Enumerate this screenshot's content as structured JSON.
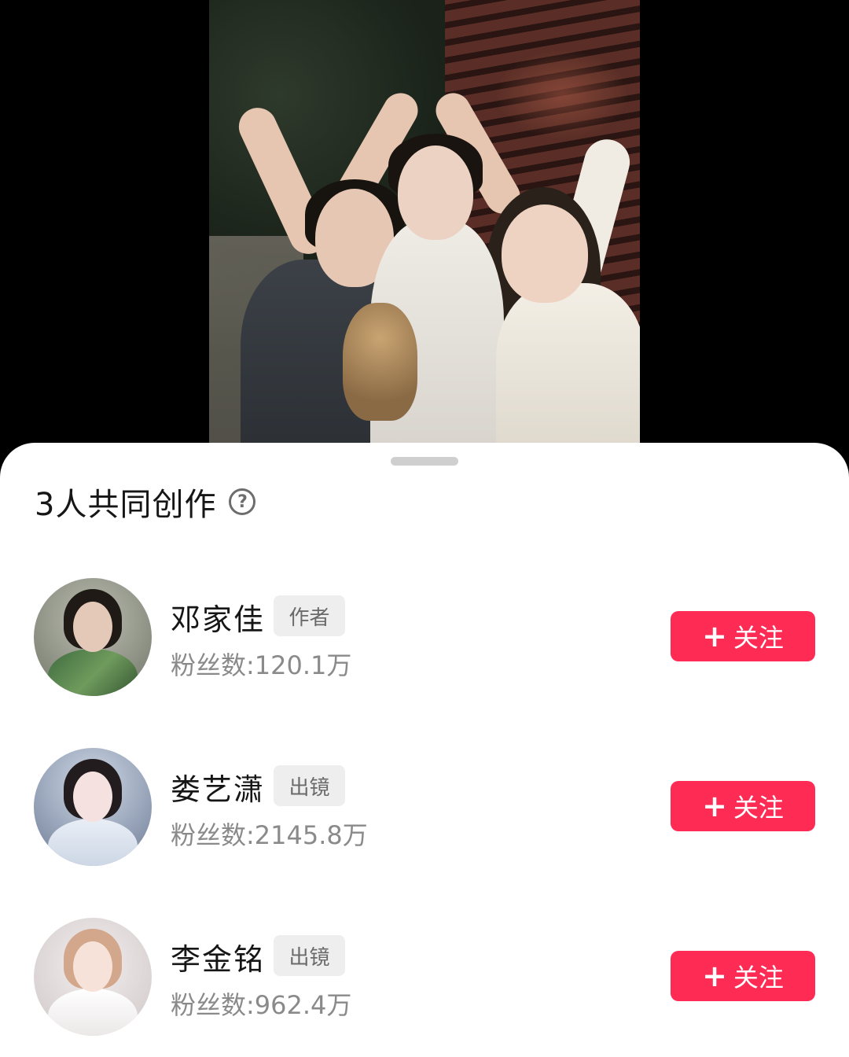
{
  "sheet": {
    "title": "3人共同创作",
    "help_icon": "question-circle-icon"
  },
  "creators": [
    {
      "name": "邓家佳",
      "role": "作者",
      "fans": "粉丝数:120.1万",
      "follow_label": "关注",
      "follow_icon": "plus-icon"
    },
    {
      "name": "娄艺潇",
      "role": "出镜",
      "fans": "粉丝数:2145.8万",
      "follow_label": "关注",
      "follow_icon": "plus-icon"
    },
    {
      "name": "李金铭",
      "role": "出镜",
      "fans": "粉丝数:962.4万",
      "follow_label": "关注",
      "follow_icon": "plus-icon"
    }
  ],
  "colors": {
    "follow_button": "#fe2c55",
    "tag_background": "#eeeeee",
    "secondary_text": "#8a8a8a"
  }
}
